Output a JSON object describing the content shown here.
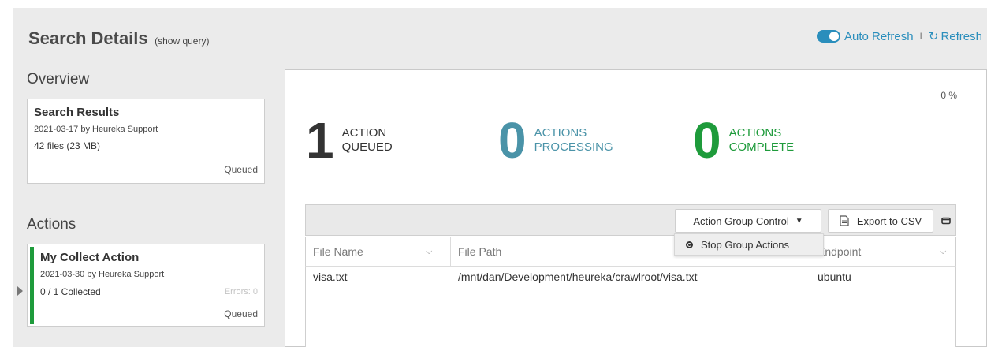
{
  "header": {
    "title": "Search Details",
    "show_query": "(show query)",
    "auto_refresh": "Auto Refresh",
    "separator": "I",
    "refresh": "Refresh"
  },
  "overview": {
    "section_title": "Overview",
    "card": {
      "title": "Search Results",
      "meta": "2021-03-17 by Heureka Support",
      "files": "42 files (23 MB)",
      "status": "Queued"
    }
  },
  "actions": {
    "section_title": "Actions",
    "card": {
      "title": "My Collect Action",
      "meta": "2021-03-30 by Heureka Support",
      "collected": "0 / 1 Collected",
      "errors": "Errors: 0",
      "status": "Queued",
      "stripe_color": "#1e9b3b"
    }
  },
  "panel": {
    "percent": "0 %",
    "stats": [
      {
        "number": "1",
        "line1": "ACTION",
        "line2": "QUEUED",
        "color": "#333333"
      },
      {
        "number": "0",
        "line1": "ACTIONS",
        "line2": "PROCESSING",
        "color": "#4a93a8"
      },
      {
        "number": "0",
        "line1": "ACTIONS",
        "line2": "COMPLETE",
        "color": "#1e9b3b"
      }
    ]
  },
  "toolbar": {
    "group_control": "Action Group Control",
    "group_control_caret": "▼",
    "export": "Export to CSV",
    "dropdown_item": "Stop Group Actions"
  },
  "table": {
    "columns": [
      "File Name",
      "File Path",
      "Endpoint"
    ],
    "rows": [
      {
        "file_name": "visa.txt",
        "file_path": "/mnt/dan/Development/heureka/crawlroot/visa.txt",
        "endpoint": "ubuntu"
      }
    ]
  },
  "icons": {
    "refresh": "refresh-icon",
    "export": "document-icon",
    "sort": "chevron-down-icon",
    "window": "minimize-icon"
  }
}
